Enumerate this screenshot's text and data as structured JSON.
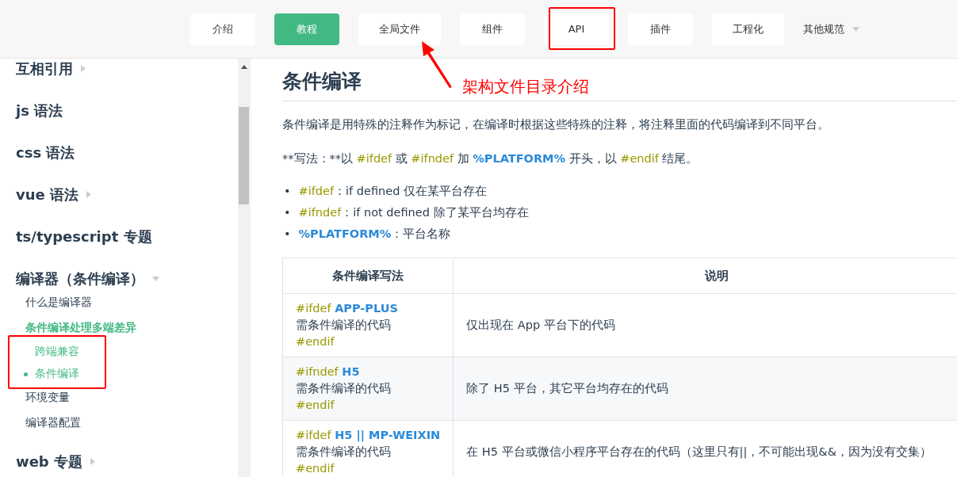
{
  "nav": {
    "items": [
      {
        "label": "介绍",
        "selected": false
      },
      {
        "label": "教程",
        "selected": true
      },
      {
        "label": "全局文件",
        "selected": false
      },
      {
        "label": "组件",
        "selected": false
      },
      {
        "label": "API",
        "selected": false
      },
      {
        "label": "插件",
        "selected": false
      },
      {
        "label": "工程化",
        "selected": false
      }
    ],
    "more": {
      "label": "其他规范"
    }
  },
  "sidebar": {
    "sections": [
      {
        "title": "互相引用",
        "expanded": false
      },
      {
        "title": "js 语法"
      },
      {
        "title": "css 语法"
      },
      {
        "title": "vue 语法",
        "expanded": false
      },
      {
        "title": "ts/typescript 专题"
      },
      {
        "title": "编译器（条件编译）",
        "expanded": true,
        "children": [
          {
            "label": "什么是编译器",
            "active": false
          },
          {
            "label": "条件编译处理多端差异",
            "active": true,
            "children": [
              {
                "label": "跨端兼容",
                "selected": false
              },
              {
                "label": "条件编译",
                "selected": true
              }
            ]
          },
          {
            "label": "环境变量",
            "active": false
          },
          {
            "label": "编译器配置",
            "active": false
          }
        ]
      },
      {
        "title": "web 专题",
        "expanded": false
      }
    ]
  },
  "content": {
    "title": "条件编译",
    "paragraphs": [
      [
        {
          "kind": "plain",
          "text": "条件编译是用特殊的注释作为标记，在编译时根据这些特殊的注释，将注释里面的代码编译到不同平台。"
        }
      ],
      [
        {
          "kind": "plain",
          "text": "**写法：**以 "
        },
        {
          "kind": "directive",
          "text": "#ifdef"
        },
        {
          "kind": "plain",
          "text": " 或 "
        },
        {
          "kind": "directive",
          "text": "#ifndef"
        },
        {
          "kind": "plain",
          "text": " 加 "
        },
        {
          "kind": "platform",
          "text": "%PLATFORM%"
        },
        {
          "kind": "plain",
          "text": " 开头，以 "
        },
        {
          "kind": "directive",
          "text": "#endif"
        },
        {
          "kind": "plain",
          "text": " 结尾。"
        }
      ]
    ],
    "bullets": [
      {
        "marker": "•",
        "segments": [
          {
            "kind": "directive",
            "text": "#ifdef"
          },
          {
            "kind": "plain",
            "text": "：if defined 仅在某平台存在"
          }
        ]
      },
      {
        "marker": "•",
        "segments": [
          {
            "kind": "directive",
            "text": "#ifndef"
          },
          {
            "kind": "plain",
            "text": "：if not defined 除了某平台均存在"
          }
        ]
      },
      {
        "marker": "•",
        "segments": [
          {
            "kind": "platform",
            "text": "%PLATFORM%"
          },
          {
            "kind": "plain",
            "text": "：平台名称"
          }
        ]
      }
    ],
    "table": {
      "columns": [
        "条件编译写法",
        "说明"
      ],
      "rows": [
        {
          "code": [
            [
              {
                "kind": "directive",
                "text": "#ifdef "
              },
              {
                "kind": "platform",
                "text": "APP-PLUS"
              }
            ],
            [
              {
                "kind": "plain",
                "text": "需条件编译的代码"
              }
            ],
            [
              {
                "kind": "directive",
                "text": "#endif"
              }
            ]
          ],
          "description": "仅出现在 App 平台下的代码"
        },
        {
          "code": [
            [
              {
                "kind": "directive",
                "text": "#ifndef "
              },
              {
                "kind": "platform",
                "text": "H5"
              }
            ],
            [
              {
                "kind": "plain",
                "text": "需条件编译的代码"
              }
            ],
            [
              {
                "kind": "directive",
                "text": "#endif"
              }
            ]
          ],
          "description": "除了 H5 平台，其它平台均存在的代码"
        },
        {
          "code": [
            [
              {
                "kind": "directive",
                "text": "#ifdef "
              },
              {
                "kind": "platform",
                "text": "H5 || MP-WEIXIN"
              }
            ],
            [
              {
                "kind": "plain",
                "text": "需条件编译的代码"
              }
            ],
            [
              {
                "kind": "directive",
                "text": "#endif"
              }
            ]
          ],
          "description": "在 H5 平台或微信小程序平台存在的代码（这里只有||，不可能出现&&，因为没有交集）"
        }
      ]
    }
  },
  "annotation": {
    "text": "架构文件目录介绍"
  }
}
